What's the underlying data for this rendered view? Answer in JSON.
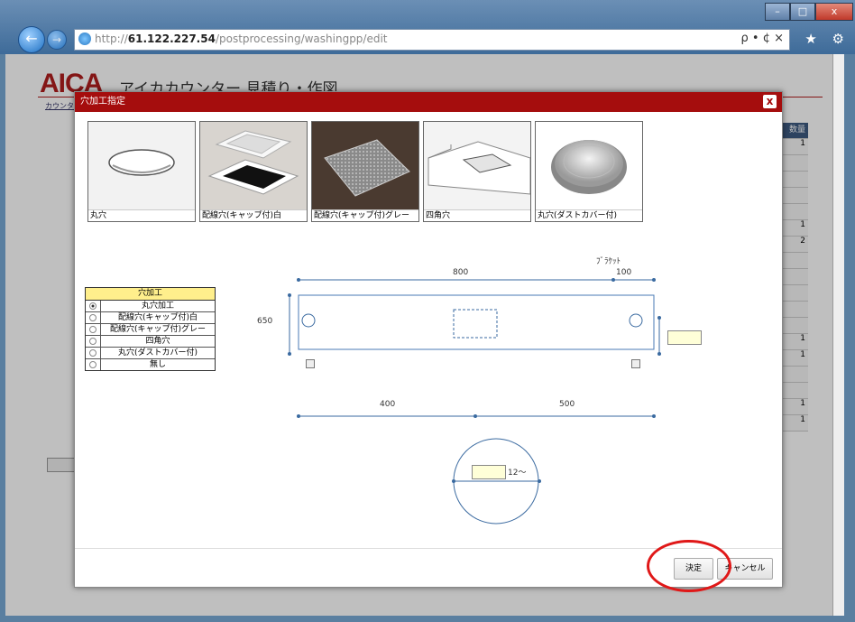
{
  "browser": {
    "url_prefix": "http://",
    "url_host": "61.122.227.54",
    "url_path": "/postprocessing/washingpp/edit",
    "addr_controls": "ρ • ¢ ×",
    "tool_icons": "⌂ ★ ⚙",
    "win_min": "–",
    "win_max": "□",
    "win_close": "x"
  },
  "page": {
    "logo": "AICA",
    "logo_sub": "アイカカウンター 見積り・作図",
    "breadcrumb": "カウンタ",
    "table_header": "数量",
    "table_values": [
      "1",
      "",
      "",
      "",
      "",
      "1",
      "2",
      "",
      "",
      "",
      "",
      "",
      "1",
      "1",
      "",
      "",
      "1",
      "1"
    ]
  },
  "modal": {
    "title": "穴加工指定",
    "close_label": "x",
    "thumbnails": [
      {
        "caption": "丸穴"
      },
      {
        "caption": "配線穴(キャップ付)白"
      },
      {
        "caption": "配線穴(キャップ付)グレー"
      },
      {
        "caption": "四角穴"
      },
      {
        "caption": "丸穴(ダストカバー付)"
      }
    ],
    "hole_table": {
      "header": "穴加工",
      "options": [
        "丸穴加工",
        "配線穴(キャップ付)白",
        "配線穴(キャップ付)グレー",
        "四角穴",
        "丸穴(ダストカバー付)",
        "無し"
      ],
      "selected_index": 0
    },
    "drawing": {
      "bracket_label": "ﾌﾞﾗｹｯﾄ",
      "dim_width": "800",
      "dim_bracket": "100",
      "dim_depth": "650",
      "dim_left": "400",
      "dim_right": "500",
      "circle_suffix": "12〜"
    },
    "buttons": {
      "ok": "決定",
      "cancel": "キャンセル"
    }
  }
}
